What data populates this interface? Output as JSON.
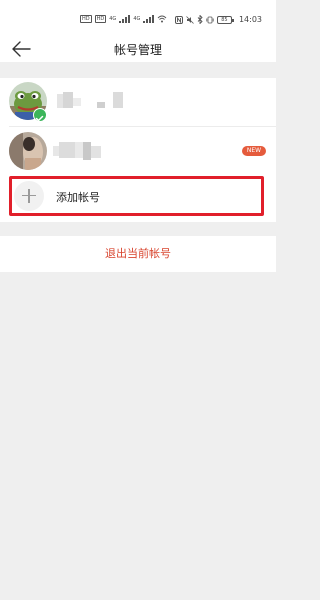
{
  "status_bar": {
    "sim1": "HD",
    "sim2": "HD",
    "net1": "4G",
    "net2": "4G",
    "battery_level": "85",
    "time": "14:03",
    "icons": [
      "nfc-icon",
      "mute-icon",
      "bluetooth-icon",
      "wifi-icon",
      "signal-icon",
      "battery-icon"
    ]
  },
  "header": {
    "title": "帐号管理",
    "back_icon": "back-arrow-icon"
  },
  "accounts": [
    {
      "avatar": "frog-avatar",
      "name": "",
      "active": true,
      "badge": ""
    },
    {
      "avatar": "photo-avatar",
      "name": "",
      "active": false,
      "badge": "NEW"
    }
  ],
  "add_account": {
    "label": "添加帐号",
    "icon": "plus-icon"
  },
  "logout": {
    "label": "退出当前帐号"
  },
  "colors": {
    "accent_red": "#d8452f",
    "highlight_border": "#e11f2a",
    "badge": "#e55b3c",
    "check": "#3bb55a",
    "background": "#efefef"
  }
}
